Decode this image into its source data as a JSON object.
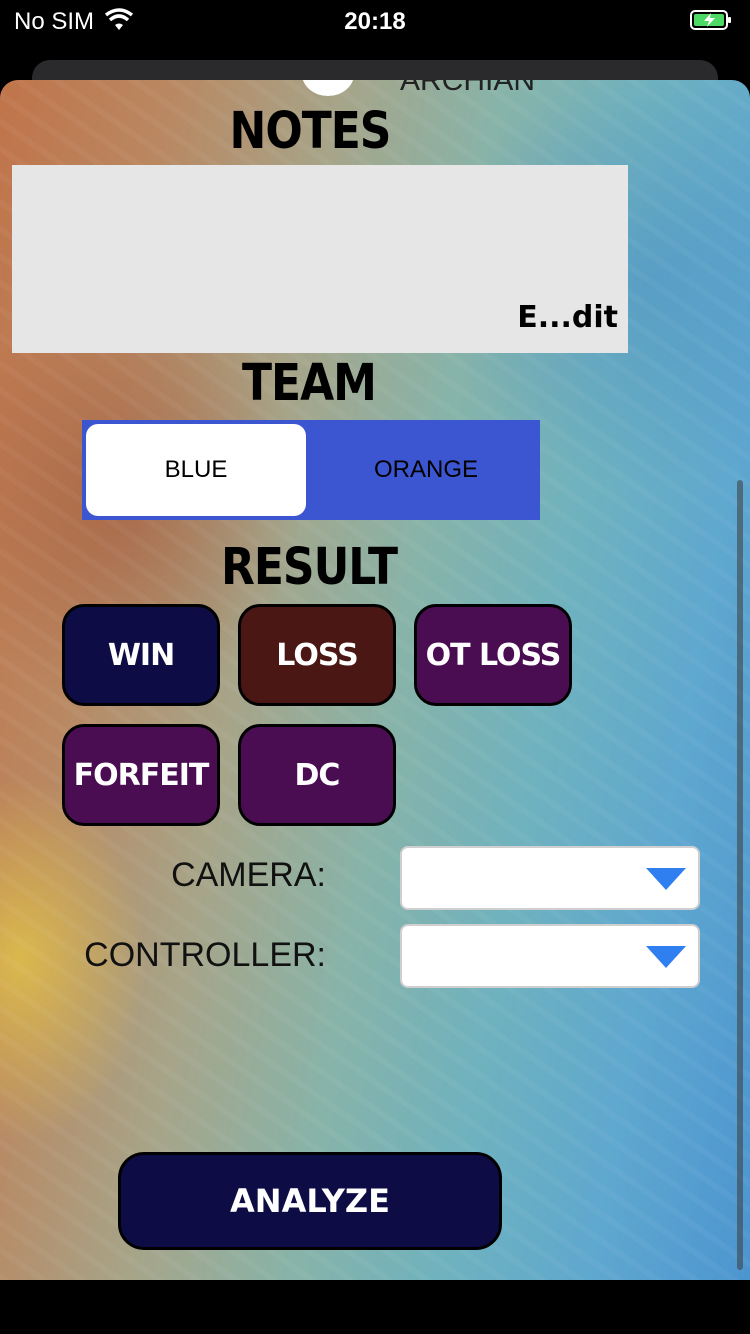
{
  "status_bar": {
    "carrier": "No SIM",
    "time": "20:18"
  },
  "partial_top_text": "ARCHIAN",
  "notes": {
    "heading": "NOTES",
    "edit_label": "E...dit"
  },
  "team": {
    "heading": "TEAM",
    "options": [
      "BLUE",
      "ORANGE"
    ],
    "selected": "BLUE"
  },
  "result": {
    "heading": "RESULT",
    "buttons": [
      {
        "label": "WIN",
        "color": "#0d0c45"
      },
      {
        "label": "LOSS",
        "color": "#4a1714"
      },
      {
        "label": "OT LOSS",
        "color": "#4a0d52"
      },
      {
        "label": "FORFEIT",
        "color": "#4a0d52"
      },
      {
        "label": "DC",
        "color": "#4a0d52"
      }
    ]
  },
  "camera": {
    "label": "CAMERA:",
    "value": ""
  },
  "controller": {
    "label": "CONTROLLER:",
    "value": ""
  },
  "analyze_label": "ANALYZE",
  "colors": {
    "segment_bg": "#3b56d0",
    "dropdown_arrow": "#2f7ff0",
    "battery": "#4cd964"
  }
}
